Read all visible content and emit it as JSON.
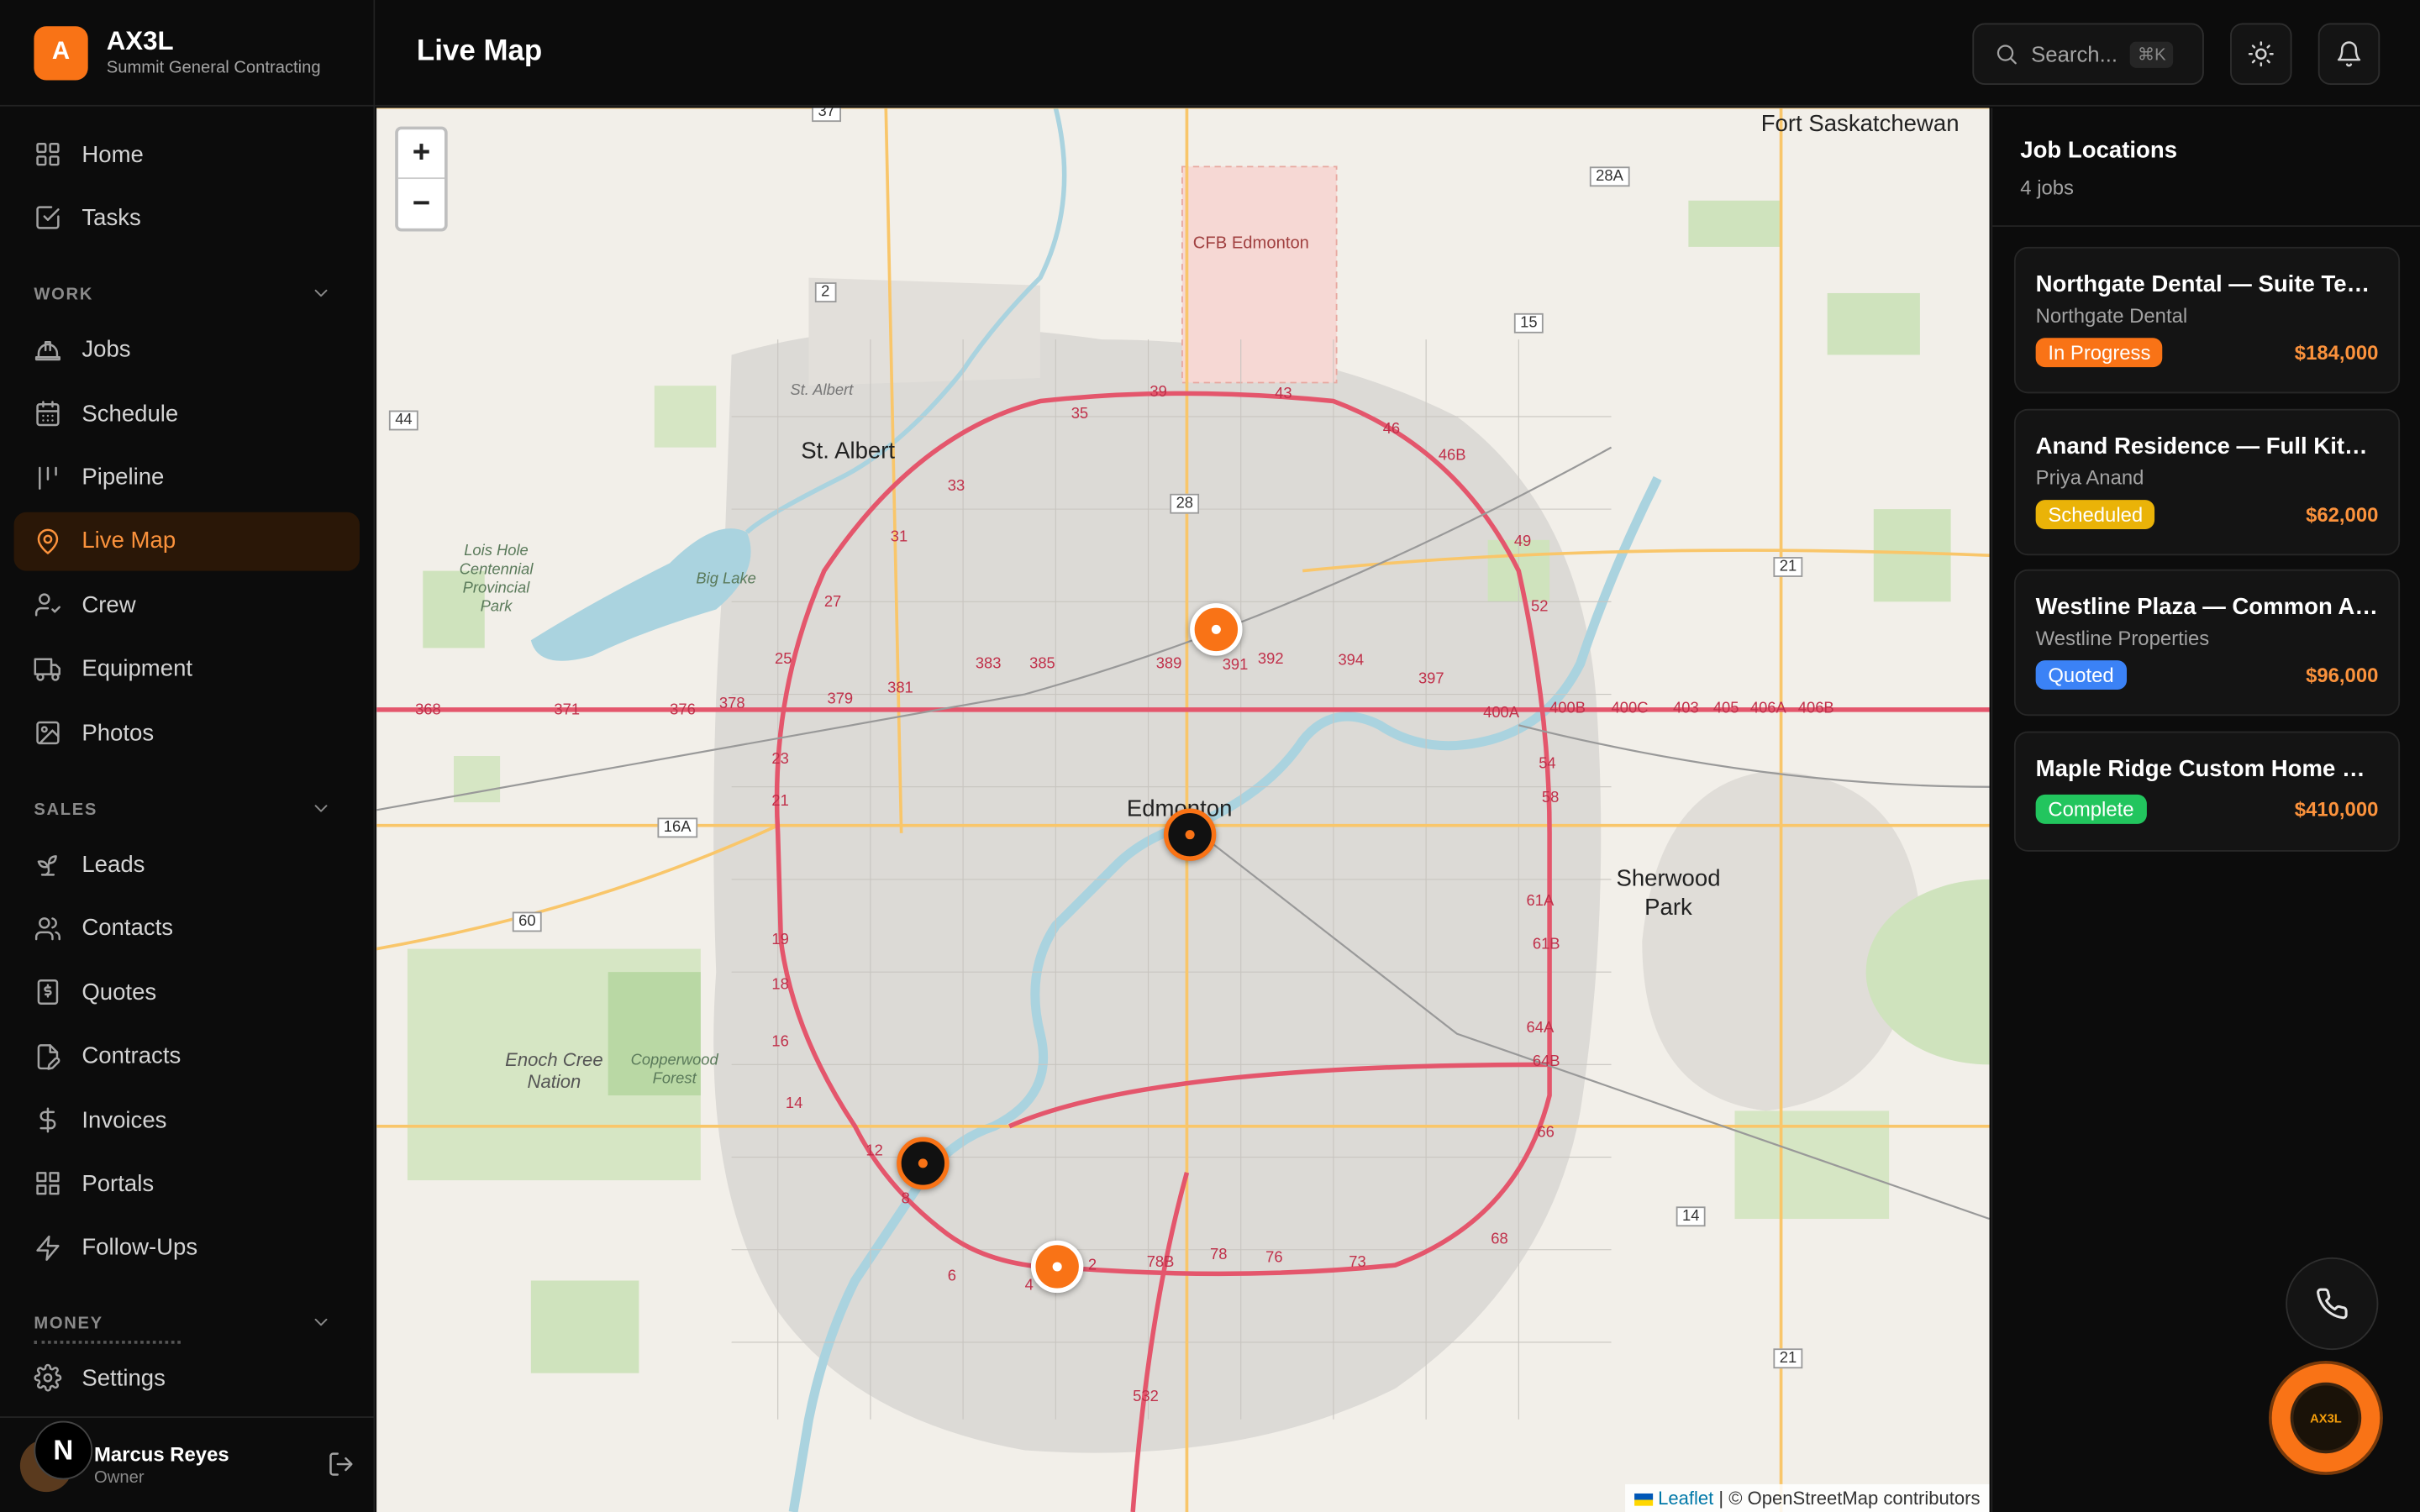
{
  "brand": {
    "logo_letter": "A",
    "name": "AX3L",
    "subtitle": "Summit General Contracting"
  },
  "nav": {
    "top": [
      {
        "label": "Home",
        "icon": "grid-icon"
      },
      {
        "label": "Tasks",
        "icon": "checkbox-icon"
      }
    ],
    "work": {
      "title": "WORK",
      "items": [
        {
          "label": "Jobs",
          "icon": "hardhat-icon"
        },
        {
          "label": "Schedule",
          "icon": "calendar-icon"
        },
        {
          "label": "Pipeline",
          "icon": "pipeline-icon"
        },
        {
          "label": "Live Map",
          "icon": "map-pin-icon",
          "active": true
        },
        {
          "label": "Crew",
          "icon": "user-check-icon"
        },
        {
          "label": "Equipment",
          "icon": "truck-icon"
        },
        {
          "label": "Photos",
          "icon": "image-icon"
        }
      ]
    },
    "sales": {
      "title": "SALES",
      "items": [
        {
          "label": "Leads",
          "icon": "sprout-icon"
        },
        {
          "label": "Contacts",
          "icon": "users-icon"
        },
        {
          "label": "Quotes",
          "icon": "receipt-icon"
        },
        {
          "label": "Contracts",
          "icon": "file-pen-icon"
        },
        {
          "label": "Invoices",
          "icon": "dollar-icon"
        },
        {
          "label": "Portals",
          "icon": "layout-grid-icon"
        },
        {
          "label": "Follow-Ups",
          "icon": "zap-icon"
        }
      ]
    },
    "money": {
      "title": "MONEY"
    },
    "settings": {
      "label": "Settings",
      "icon": "gear-icon"
    }
  },
  "user": {
    "name": "Marcus Reyes",
    "role": "Owner",
    "badge_letter": "N"
  },
  "header": {
    "title": "Live Map",
    "search_placeholder": "Search...",
    "search_shortcut": "⌘K"
  },
  "map": {
    "zoom_in": "+",
    "zoom_out": "−",
    "attribution_link": "Leaflet",
    "attribution_text": "| © OpenStreetMap contributors",
    "labels": {
      "fort_sask": "Fort Saskatchewan",
      "cfb": "CFB Edmonton",
      "st_albert": "St. Albert",
      "st_albert_small": "St. Albert",
      "edmonton": "Edmonton",
      "sherwood": "Sherwood Park",
      "lois_hole": "Lois Hole Centennial Provincial Park",
      "big_lake": "Big Lake",
      "enoch": "Enoch Cree Nation",
      "copperwood": "Copperwood Forest"
    },
    "road_shields": {
      "r2": "2",
      "r44": "44",
      "r16a": "16A",
      "r60": "60",
      "r15": "15",
      "r28a": "28A",
      "r21": "21",
      "r14": "14",
      "r21b": "21",
      "r28": "28",
      "r37": "37"
    },
    "ring_road_numbers": {
      "n35": "35",
      "n39": "39",
      "n43": "43",
      "n46": "46",
      "n389": "389",
      "n391": "391",
      "n392": "392",
      "n394": "394",
      "n397": "397",
      "n400a": "400A",
      "n400b": "400B",
      "n400c": "400C",
      "n403": "403",
      "n405": "405",
      "n406a": "406A",
      "n406b": "406B",
      "n383": "383",
      "n385": "385",
      "n381": "381",
      "n379": "379",
      "n378": "378",
      "n376": "376",
      "n371": "371",
      "n368": "368",
      "n52": "52",
      "n54": "54",
      "n58": "58",
      "n61a": "61A",
      "n61b": "61B",
      "n64a": "64A",
      "n64b": "64B",
      "n66": "66",
      "n68": "68",
      "n73": "73",
      "n76": "76",
      "n78": "78",
      "n78b": "78B",
      "n532": "532",
      "n12": "12",
      "n14": "14",
      "n16": "16",
      "n18": "18",
      "n19": "19",
      "n21": "21",
      "n23": "23",
      "n25": "25",
      "n27": "27",
      "n31": "31",
      "n33": "33",
      "n6": "6",
      "n4": "4",
      "n8": "8",
      "n49": "49",
      "n46b": "46B",
      "n2": "2"
    }
  },
  "jobs_panel": {
    "title": "Job Locations",
    "count": "4 jobs",
    "jobs": [
      {
        "title": "Northgate Dental — Suite Tenant Improvement",
        "client": "Northgate Dental",
        "status": "In Progress",
        "status_color": "#f97316",
        "price": "$184,000"
      },
      {
        "title": "Anand Residence — Full Kitchen Remodel",
        "client": "Priya Anand",
        "status": "Scheduled",
        "status_color": "#eab308",
        "price": "$62,000"
      },
      {
        "title": "Westline Plaza — Common Area Refresh",
        "client": "Westline Properties",
        "status": "Quoted",
        "status_color": "#3b82f6",
        "price": "$96,000"
      },
      {
        "title": "Maple Ridge Custom Home — New Build",
        "client": "",
        "status": "Complete",
        "status_color": "#22c55e",
        "price": "$410,000"
      }
    ]
  },
  "fab": {
    "avatar_text": "AX3L"
  },
  "colors": {
    "accent": "#f97316",
    "background": "#0a0a0a",
    "panel": "#141414"
  }
}
